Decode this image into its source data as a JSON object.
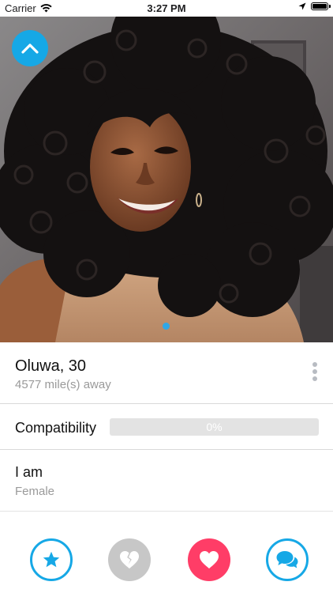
{
  "status_bar": {
    "carrier": "Carrier",
    "time": "3:27 PM"
  },
  "profile": {
    "name_age": "Oluwa, 30",
    "distance": "4577 mile(s) away",
    "photo_pages": 1,
    "current_photo_index": 0
  },
  "compatibility": {
    "label": "Compatibility",
    "percent_text": "0%",
    "value": 0
  },
  "gender": {
    "label": "I am",
    "value": "Female"
  },
  "actions": {
    "favorite_icon": "star-icon",
    "pass_icon": "broken-heart-icon",
    "like_icon": "heart-icon",
    "chat_icon": "chat-bubbles-icon"
  },
  "colors": {
    "accent_blue": "#16a8e6",
    "like_pink": "#ff3d67",
    "pass_gray": "#c7c7c7",
    "progress_track": "#e3e3e3"
  }
}
